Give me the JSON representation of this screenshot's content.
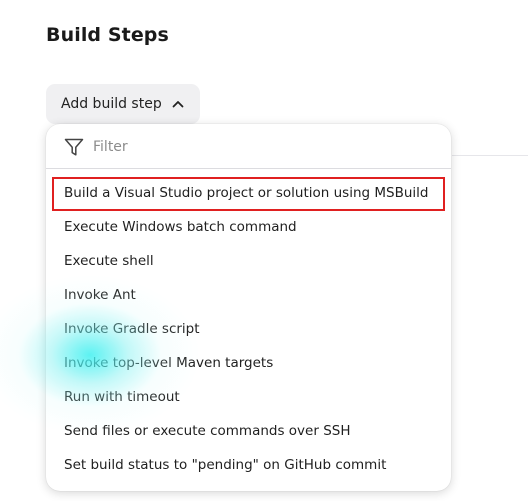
{
  "section": {
    "title": "Build Steps"
  },
  "add_button": {
    "label": "Add build step",
    "icon": "chevron-up-icon"
  },
  "dropdown": {
    "filter": {
      "placeholder": "Filter",
      "value": "",
      "icon": "filter-icon"
    },
    "items": [
      {
        "label": "Build a Visual Studio project or solution using MSBuild"
      },
      {
        "label": "Execute Windows batch command"
      },
      {
        "label": "Execute shell"
      },
      {
        "label": "Invoke Ant"
      },
      {
        "label": "Invoke Gradle script"
      },
      {
        "label": "Invoke top-level Maven targets"
      },
      {
        "label": "Run with timeout"
      },
      {
        "label": "Send files or execute commands over SSH"
      },
      {
        "label": "Set build status to \"pending\" on GitHub commit"
      }
    ]
  },
  "colors": {
    "highlight_border": "#e02020",
    "button_bg": "#f0f0f2",
    "glow": "#40f0f0"
  }
}
